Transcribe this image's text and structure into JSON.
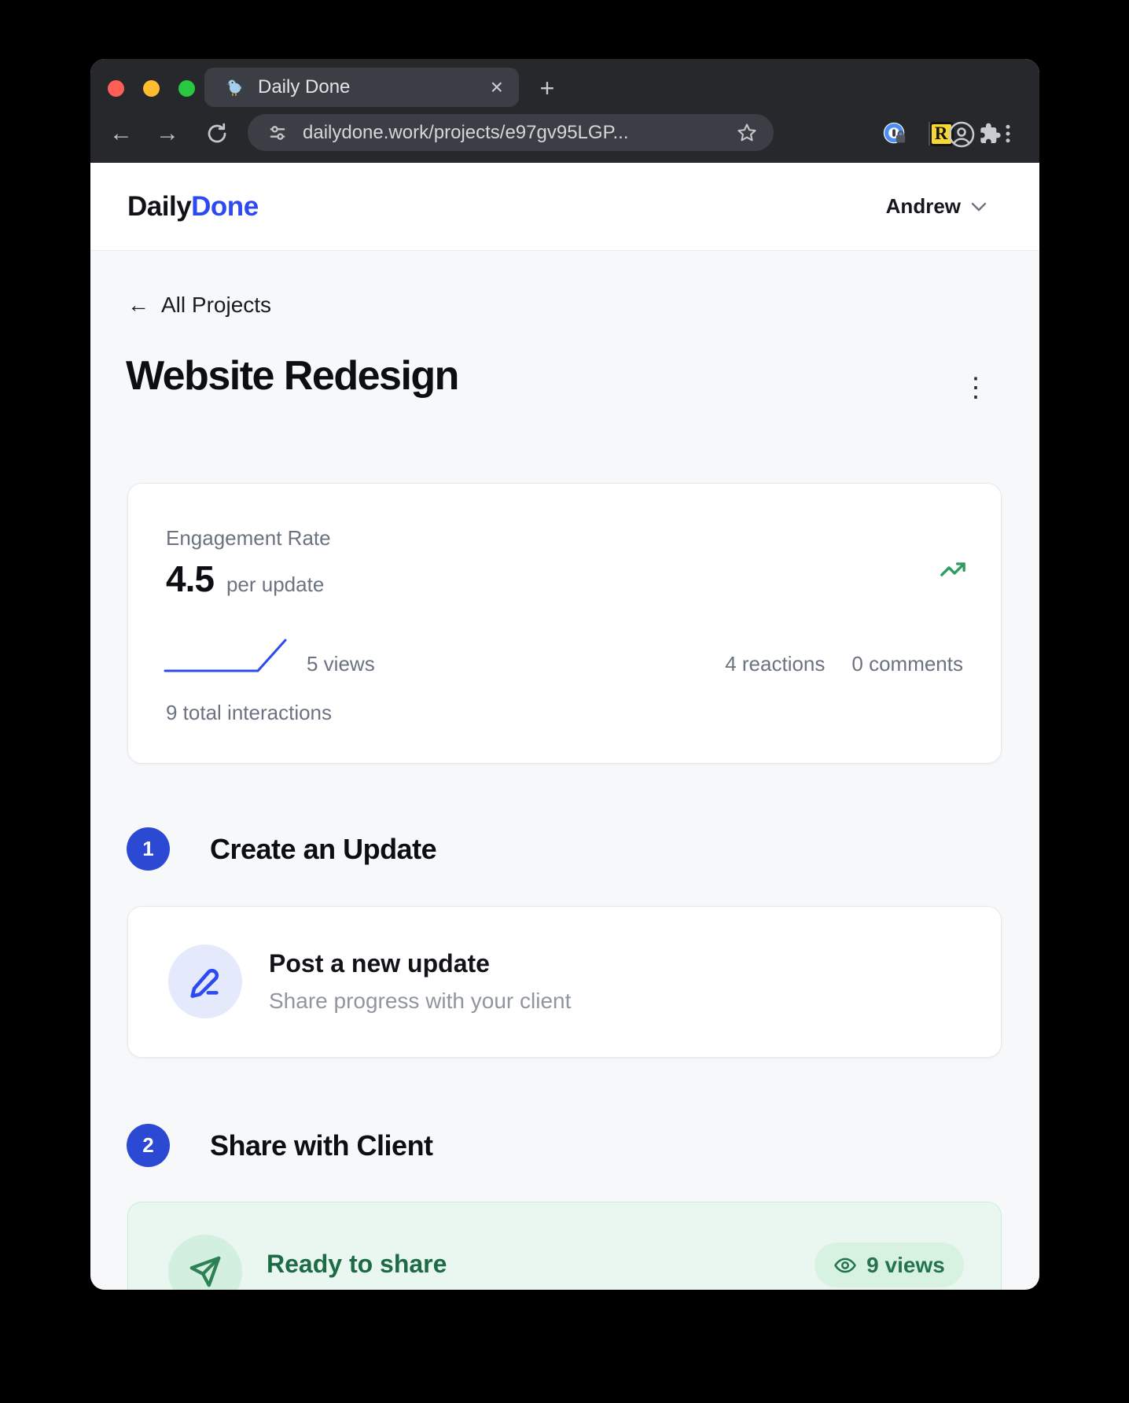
{
  "browser": {
    "tab_title": "Daily Done",
    "url": "dailydone.work/projects/e97gv95LGP...",
    "extension_r_label": "R"
  },
  "icons": {
    "close": "×",
    "plus": "+",
    "back_arrow": "←",
    "forward_arrow": "→",
    "kebab": "⋮",
    "nav_back_arrow": "←"
  },
  "header": {
    "logo_part1": "Daily",
    "logo_part2": "Done",
    "user_name": "Andrew"
  },
  "page": {
    "back_link": "All Projects",
    "title": "Website Redesign",
    "engagement": {
      "label": "Engagement Rate",
      "rate": "4.5",
      "rate_suffix": "per update",
      "views": "5 views",
      "reactions": "4 reactions",
      "comments": "0 comments",
      "total": "9 total interactions"
    },
    "step1": {
      "number": "1",
      "title": "Create an Update",
      "card_title": "Post a new update",
      "card_subtitle": "Share progress with your client"
    },
    "step2": {
      "number": "2",
      "title": "Share with Client",
      "card_title": "Ready to share",
      "badge": "9 views"
    }
  },
  "colors": {
    "accent_blue": "#2c4af0",
    "step_blue": "#2c49d4",
    "trend_green": "#2e9e62",
    "dark_green": "#1d6b44",
    "card_green_bg": "#eaf7f0"
  }
}
